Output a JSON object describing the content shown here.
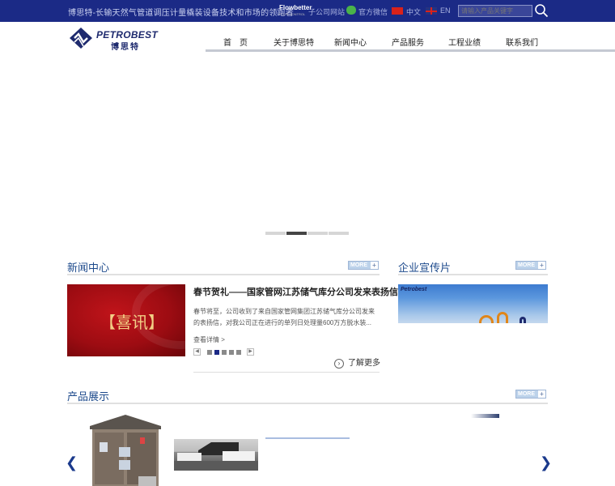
{
  "topbar": {
    "tagline": "博思特-长输天然气管道调压计量橇装设备技术和市场的领跑者",
    "flowbetter_brand": "Flowbetter",
    "flowbetter_sub": "FLOW CONTROL",
    "partner_site_label": "子公司网站",
    "wechat_label": "官方微信",
    "lang_cn": "中文",
    "lang_en": "EN",
    "search_placeholder": "请输入产品关键字"
  },
  "header": {
    "logo_en": "PETROBEST",
    "logo_cn": "博思特"
  },
  "nav": {
    "items": [
      {
        "label": "首　页"
      },
      {
        "label": "关于博思特"
      },
      {
        "label": "新闻中心"
      },
      {
        "label": "产品服务"
      },
      {
        "label": "工程业绩"
      },
      {
        "label": "联系我们"
      }
    ]
  },
  "banner": {
    "slide_count": 4,
    "active_slide": 2
  },
  "news": {
    "section_title": "新闻中心",
    "more_label": "MORE",
    "image_caption": "【喜讯】",
    "headline": "春节贺礼——国家管网江苏储气库分公司发来表扬信！",
    "summary": "春节将至，公司收到了来自国家管网集团江苏储气库分公司发来的表扬信，对我公司正在进行的单列日处理量600万方脱水装...",
    "detail_link": "查看详情 >",
    "pager_count": 5,
    "pager_active": 2,
    "learn_more": "了解更多"
  },
  "video": {
    "section_title": "企业宣传片",
    "more_label": "MORE",
    "thumb_logo": "Petrobest"
  },
  "products": {
    "section_title": "产品展示",
    "more_label": "MORE"
  },
  "colors": {
    "topbar_bg": "#1b2a86",
    "section_title": "#1d4a8c",
    "brand_navy": "#1e2a6e"
  }
}
